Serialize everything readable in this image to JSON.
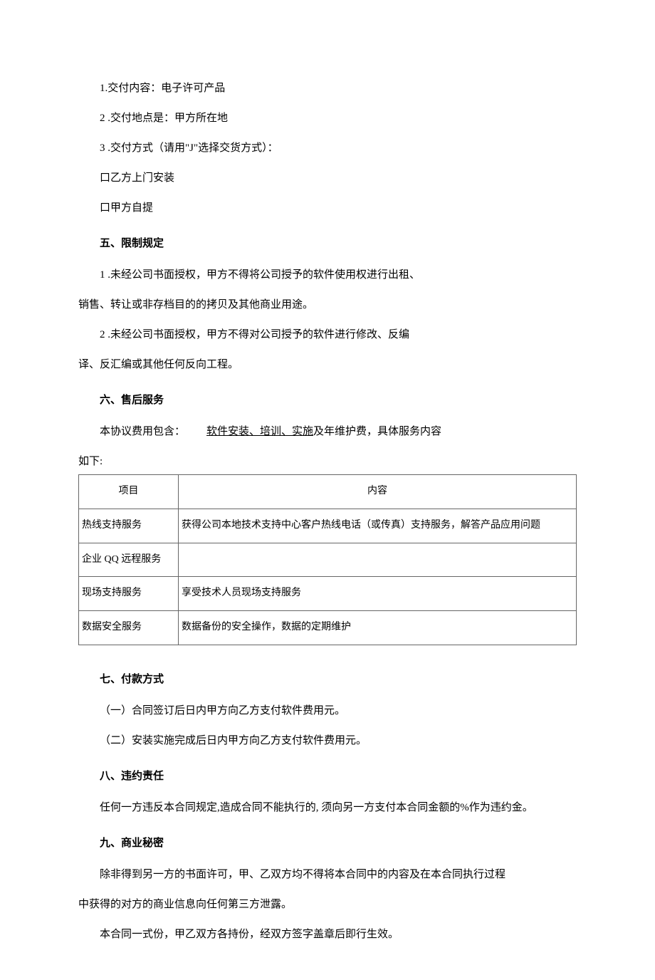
{
  "paragraphs": {
    "p1": "1.交付内容：电子许可产品",
    "p2": "2 .交付地点是：甲方所在地",
    "p3": "3 .交付方式（请用\"J\"选择交货方式）：",
    "p4": "口乙方上门安装",
    "p5": "口甲方自提"
  },
  "section5": {
    "title": "五、限制规定",
    "p1a": "1 .未经公司书面授权，甲方不得将公司授予的软件使用权进行出租、",
    "p1b": "销售、转让或非存档目的的拷贝及其他商业用途。",
    "p2a": "2 .未经公司书面授权，甲方不得对公司授予的软件进行修改、反编",
    "p2b": "译、反汇编或其他任何反向工程。"
  },
  "section6": {
    "title": "六、售后服务",
    "intro_prefix": "本协议费用包含：",
    "intro_underline": "软件安装、培训、实施",
    "intro_suffix": "及年维护费，具体服务内容",
    "before_table": "如下:"
  },
  "table": {
    "header_item": "项目",
    "header_content": "内容",
    "rows": [
      {
        "item": "热线支持服务",
        "content": "获得公司本地技术支持中心客户热线电话（或传真）支持服务，解答产品应用问题"
      },
      {
        "item": "企业 QQ 远程服务",
        "content": ""
      },
      {
        "item": "现场支持服务",
        "content": "享受技术人员现场支持服务"
      },
      {
        "item": "数据安全服务",
        "content": "数据备份的安全操作，数据的定期维护"
      }
    ]
  },
  "section7": {
    "title": "七、付款方式",
    "p1": "（一）合同签订后日内甲方向乙方支付软件费用元。",
    "p2": "（二）安装实施完成后日内甲方向乙方支付软件费用元。"
  },
  "section8": {
    "title": "八、违约责任",
    "p1": "任何一方违反本合同规定,造成合同不能执行的, 须向另一方支付本合同金额的%作为违约金。"
  },
  "section9": {
    "title": "九、商业秘密",
    "p1a": "除非得到另一方的书面许可，甲、乙双方均不得将本合同中的内容及在本合同执行过程",
    "p1b": "中获得的对方的商业信息向任何第三方泄露。",
    "p2": "本合同一式份，甲乙双方各持份，经双方签字盖章后即行生效。"
  }
}
